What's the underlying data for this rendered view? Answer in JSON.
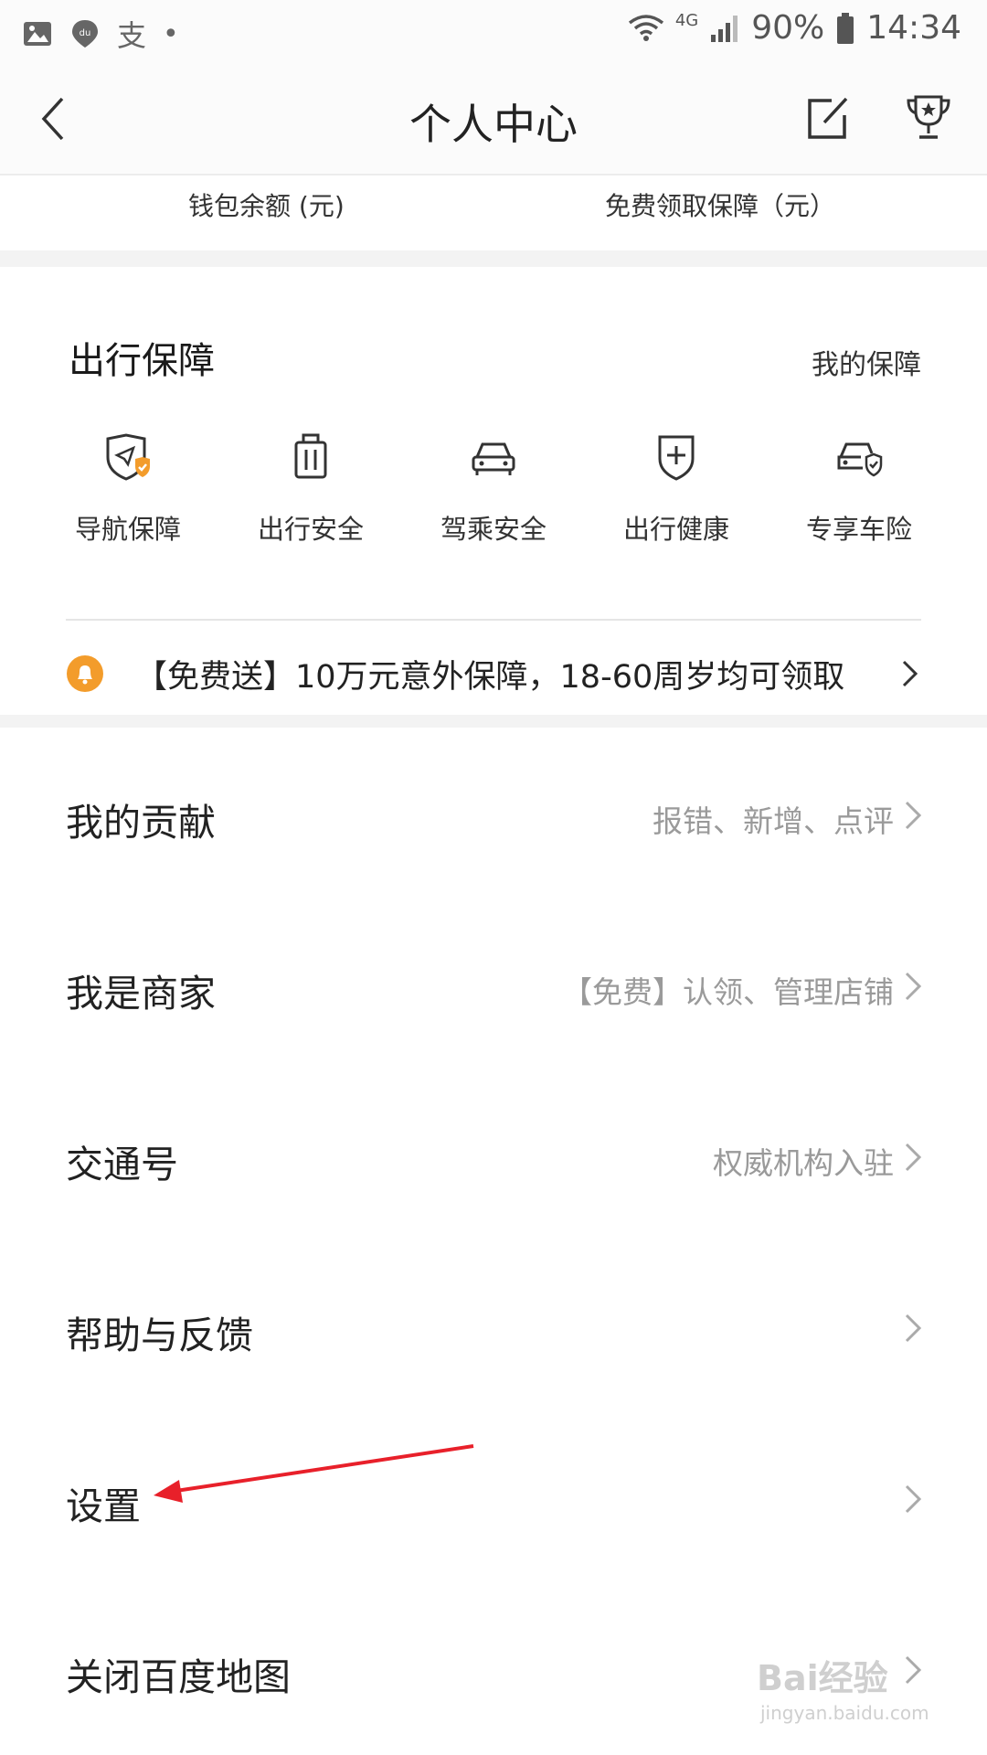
{
  "status_bar": {
    "carrier_glyph": "支",
    "dot": "•",
    "network": "4G",
    "battery": "90%",
    "time": "14:34",
    "icons": [
      "gallery-icon",
      "baidu-map-icon",
      "alipay-icon",
      "wifi-icon",
      "signal-icon",
      "battery-icon"
    ]
  },
  "header": {
    "title": "个人中心",
    "icons": [
      "back-icon",
      "edit-icon",
      "trophy-icon"
    ]
  },
  "wallet": {
    "balance_label": "钱包余额 (元)",
    "free_protection_label": "免费领取保障（元）"
  },
  "travel": {
    "title": "出行保障",
    "link": "我的保障",
    "items": [
      {
        "label": "导航保障",
        "icon": "nav-shield-icon"
      },
      {
        "label": "出行安全",
        "icon": "luggage-icon"
      },
      {
        "label": "驾乘安全",
        "icon": "car-icon"
      },
      {
        "label": "出行健康",
        "icon": "health-shield-icon"
      },
      {
        "label": "专享车险",
        "icon": "car-insurance-icon"
      }
    ],
    "promo": {
      "text": "【免费送】10万元意外保障，18-60周岁均可领取",
      "icon": "bell-icon"
    }
  },
  "menu": [
    {
      "label": "我的贡献",
      "hint": "报错、新增、点评"
    },
    {
      "label": "我是商家",
      "hint": "【免费】认领、管理店铺"
    },
    {
      "label": "交通号",
      "hint": "权威机构入驻"
    },
    {
      "label": "帮助与反馈",
      "hint": ""
    },
    {
      "label": "设置",
      "hint": ""
    },
    {
      "label": "关闭百度地图",
      "hint": ""
    }
  ],
  "watermark": {
    "brand": "Bai经验",
    "url": "jingyan.baidu.com"
  },
  "colors": {
    "accent_orange": "#f39c2b",
    "annotation_red": "#e8202a"
  }
}
